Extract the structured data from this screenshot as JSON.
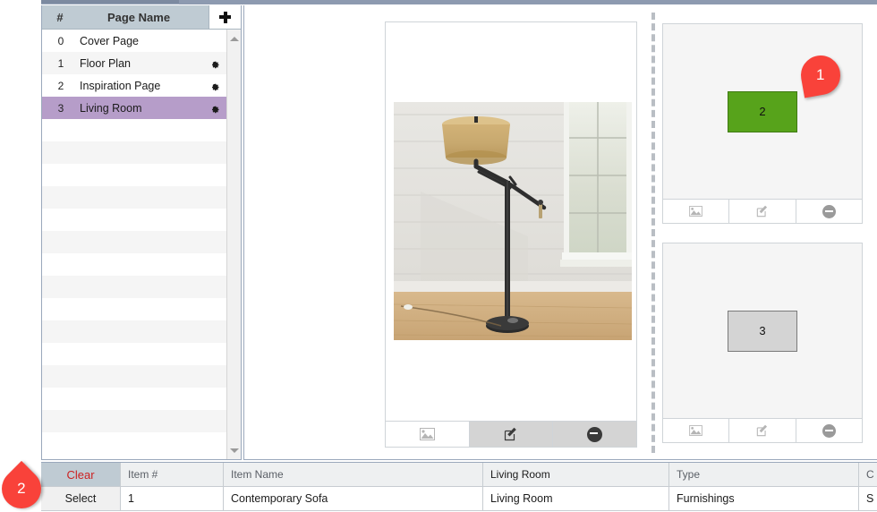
{
  "sidebar": {
    "header": {
      "num_label": "#",
      "name_label": "Page Name",
      "add_icon": "plus-icon"
    },
    "pages": [
      {
        "num": "0",
        "name": "Cover Page",
        "gear": false,
        "selected": false
      },
      {
        "num": "1",
        "name": "Floor Plan",
        "gear": true,
        "selected": false
      },
      {
        "num": "2",
        "name": "Inspiration Page",
        "gear": true,
        "selected": false
      },
      {
        "num": "3",
        "name": "Living Room",
        "gear": true,
        "selected": true
      }
    ],
    "empty_row_count": 15,
    "scroll_up_icon": "triangle-up-icon",
    "scroll_down_icon": "triangle-down-icon"
  },
  "canvas": {
    "page_card": {
      "photo_alt": "floor-lamp-photo",
      "toolbar": [
        {
          "icon": "image-icon",
          "style": "white"
        },
        {
          "icon": "edit-pencil-icon",
          "style": "gray"
        },
        {
          "icon": "remove-minus-icon",
          "style": "gray"
        }
      ]
    },
    "thumbnails": [
      {
        "shape_label": "2",
        "shape_color": "#57a31b",
        "shape_style": "green",
        "toolbar": [
          {
            "icon": "image-icon"
          },
          {
            "icon": "edit-pencil-icon"
          },
          {
            "icon": "remove-minus-icon"
          }
        ]
      },
      {
        "shape_label": "3",
        "shape_color": "#d4d4d4",
        "shape_style": "gray",
        "toolbar": [
          {
            "icon": "image-icon"
          },
          {
            "icon": "edit-pencil-icon"
          },
          {
            "icon": "remove-minus-icon"
          }
        ]
      }
    ]
  },
  "bottom_table": {
    "headers": {
      "action": "Clear",
      "item_number": "Item #",
      "item_name": "Item Name",
      "room": "Living Room",
      "type": "Type",
      "last": "C"
    },
    "rows": [
      {
        "action": "Select",
        "item_number": "1",
        "item_name": "Contemporary Sofa",
        "room": "Living Room",
        "type": "Furnishings",
        "last": "S"
      }
    ]
  },
  "callouts": [
    {
      "id": "1",
      "label": "1",
      "color": "#f9423a"
    },
    {
      "id": "2",
      "label": "2",
      "color": "#f9423a"
    }
  ]
}
